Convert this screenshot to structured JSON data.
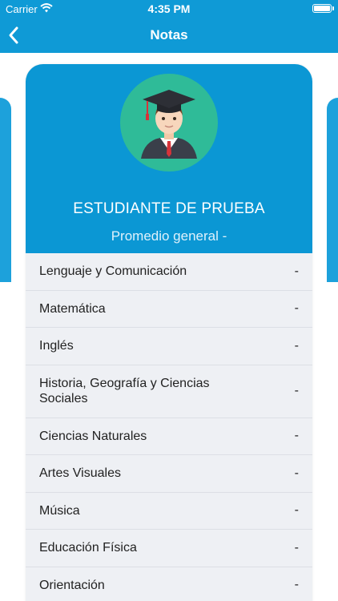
{
  "status_bar": {
    "carrier": "Carrier",
    "time": "4:35 PM"
  },
  "nav": {
    "title": "Notas"
  },
  "student": {
    "name": "ESTUDIANTE DE PRUEBA",
    "average": "Promedio general -"
  },
  "subjects": [
    {
      "name": "Lenguaje y Comunicación",
      "grade": "-"
    },
    {
      "name": "Matemática",
      "grade": "-"
    },
    {
      "name": "Inglés",
      "grade": "-"
    },
    {
      "name": "Historia, Geografía y Ciencias Sociales",
      "grade": "-"
    },
    {
      "name": "Ciencias Naturales",
      "grade": "-"
    },
    {
      "name": "Artes Visuales",
      "grade": "-"
    },
    {
      "name": "Música",
      "grade": "-"
    },
    {
      "name": "Educación Física",
      "grade": "-"
    },
    {
      "name": "Orientación",
      "grade": "-"
    }
  ],
  "colors": {
    "primary": "#0f9ad6",
    "avatar_bg": "#2fbb98",
    "list_bg": "#eef0f4"
  }
}
